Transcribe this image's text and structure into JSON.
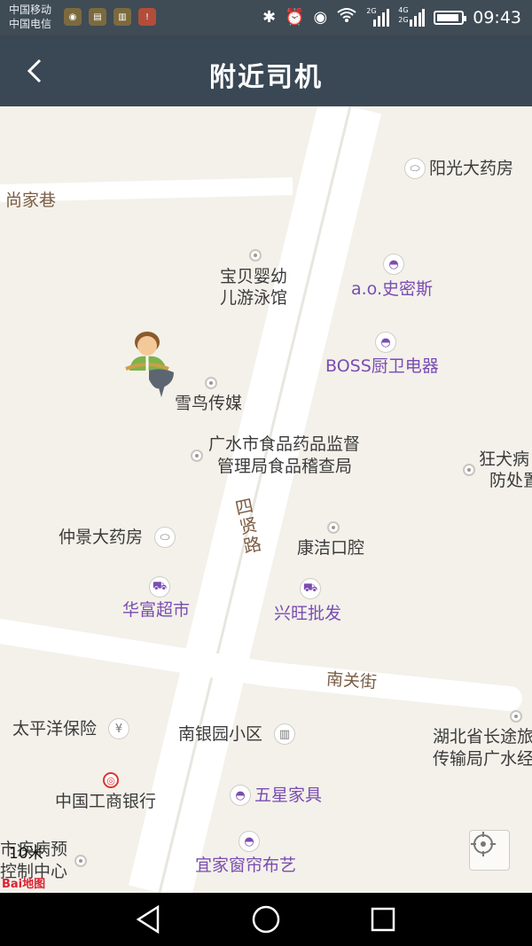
{
  "status_bar": {
    "carrier_1": "中国移动",
    "carrier_2": "中国电信",
    "time": "09:43",
    "net_1": "2G",
    "net_2": "4G",
    "net_3": "2G"
  },
  "header": {
    "title": "附近司机"
  },
  "map": {
    "roads": {
      "alley": "尚家巷",
      "main": "四贤路",
      "street": "南关街"
    },
    "pois": {
      "yangguang": "阳光大药房",
      "baobei_1": "宝贝婴幼",
      "baobei_2": "儿游泳馆",
      "ao": "a.o.史密斯",
      "boss": "BOSS厨卫电器",
      "xueniao": "雪鸟传媒",
      "shipin_1": "广水市食品药品监督",
      "shipin_2": "管理局食品稽查局",
      "kuangquan_1": "狂犬病",
      "kuangquan_2": "防处置",
      "zhongjing": "仲景大药房",
      "kangjie": "康洁口腔",
      "huafu": "华富超市",
      "xingwang": "兴旺批发",
      "taipingyang": "太平洋保险",
      "nanyinyuan": "南银园小区",
      "hubei_1": "湖北省长途旅",
      "hubei_2": "传输局广水经",
      "gongshang": "中国工商银行",
      "wuxing": "五星家具",
      "jibing_1": "市疾病预",
      "jibing_2": "控制中心",
      "yijia": "宜家窗帘布艺"
    },
    "scale_label": "10米",
    "logo": "Bai地图"
  },
  "colors": {
    "title_bar": "#3a4855",
    "map_bg": "#f3f1ea",
    "poi_purple": "#7a4cb3"
  },
  "icons": {
    "back": "chevron-left-icon",
    "locate": "crosshair-icon",
    "nav_back": "triangle-back-icon",
    "nav_home": "circle-home-icon",
    "nav_recent": "square-recent-icon"
  }
}
